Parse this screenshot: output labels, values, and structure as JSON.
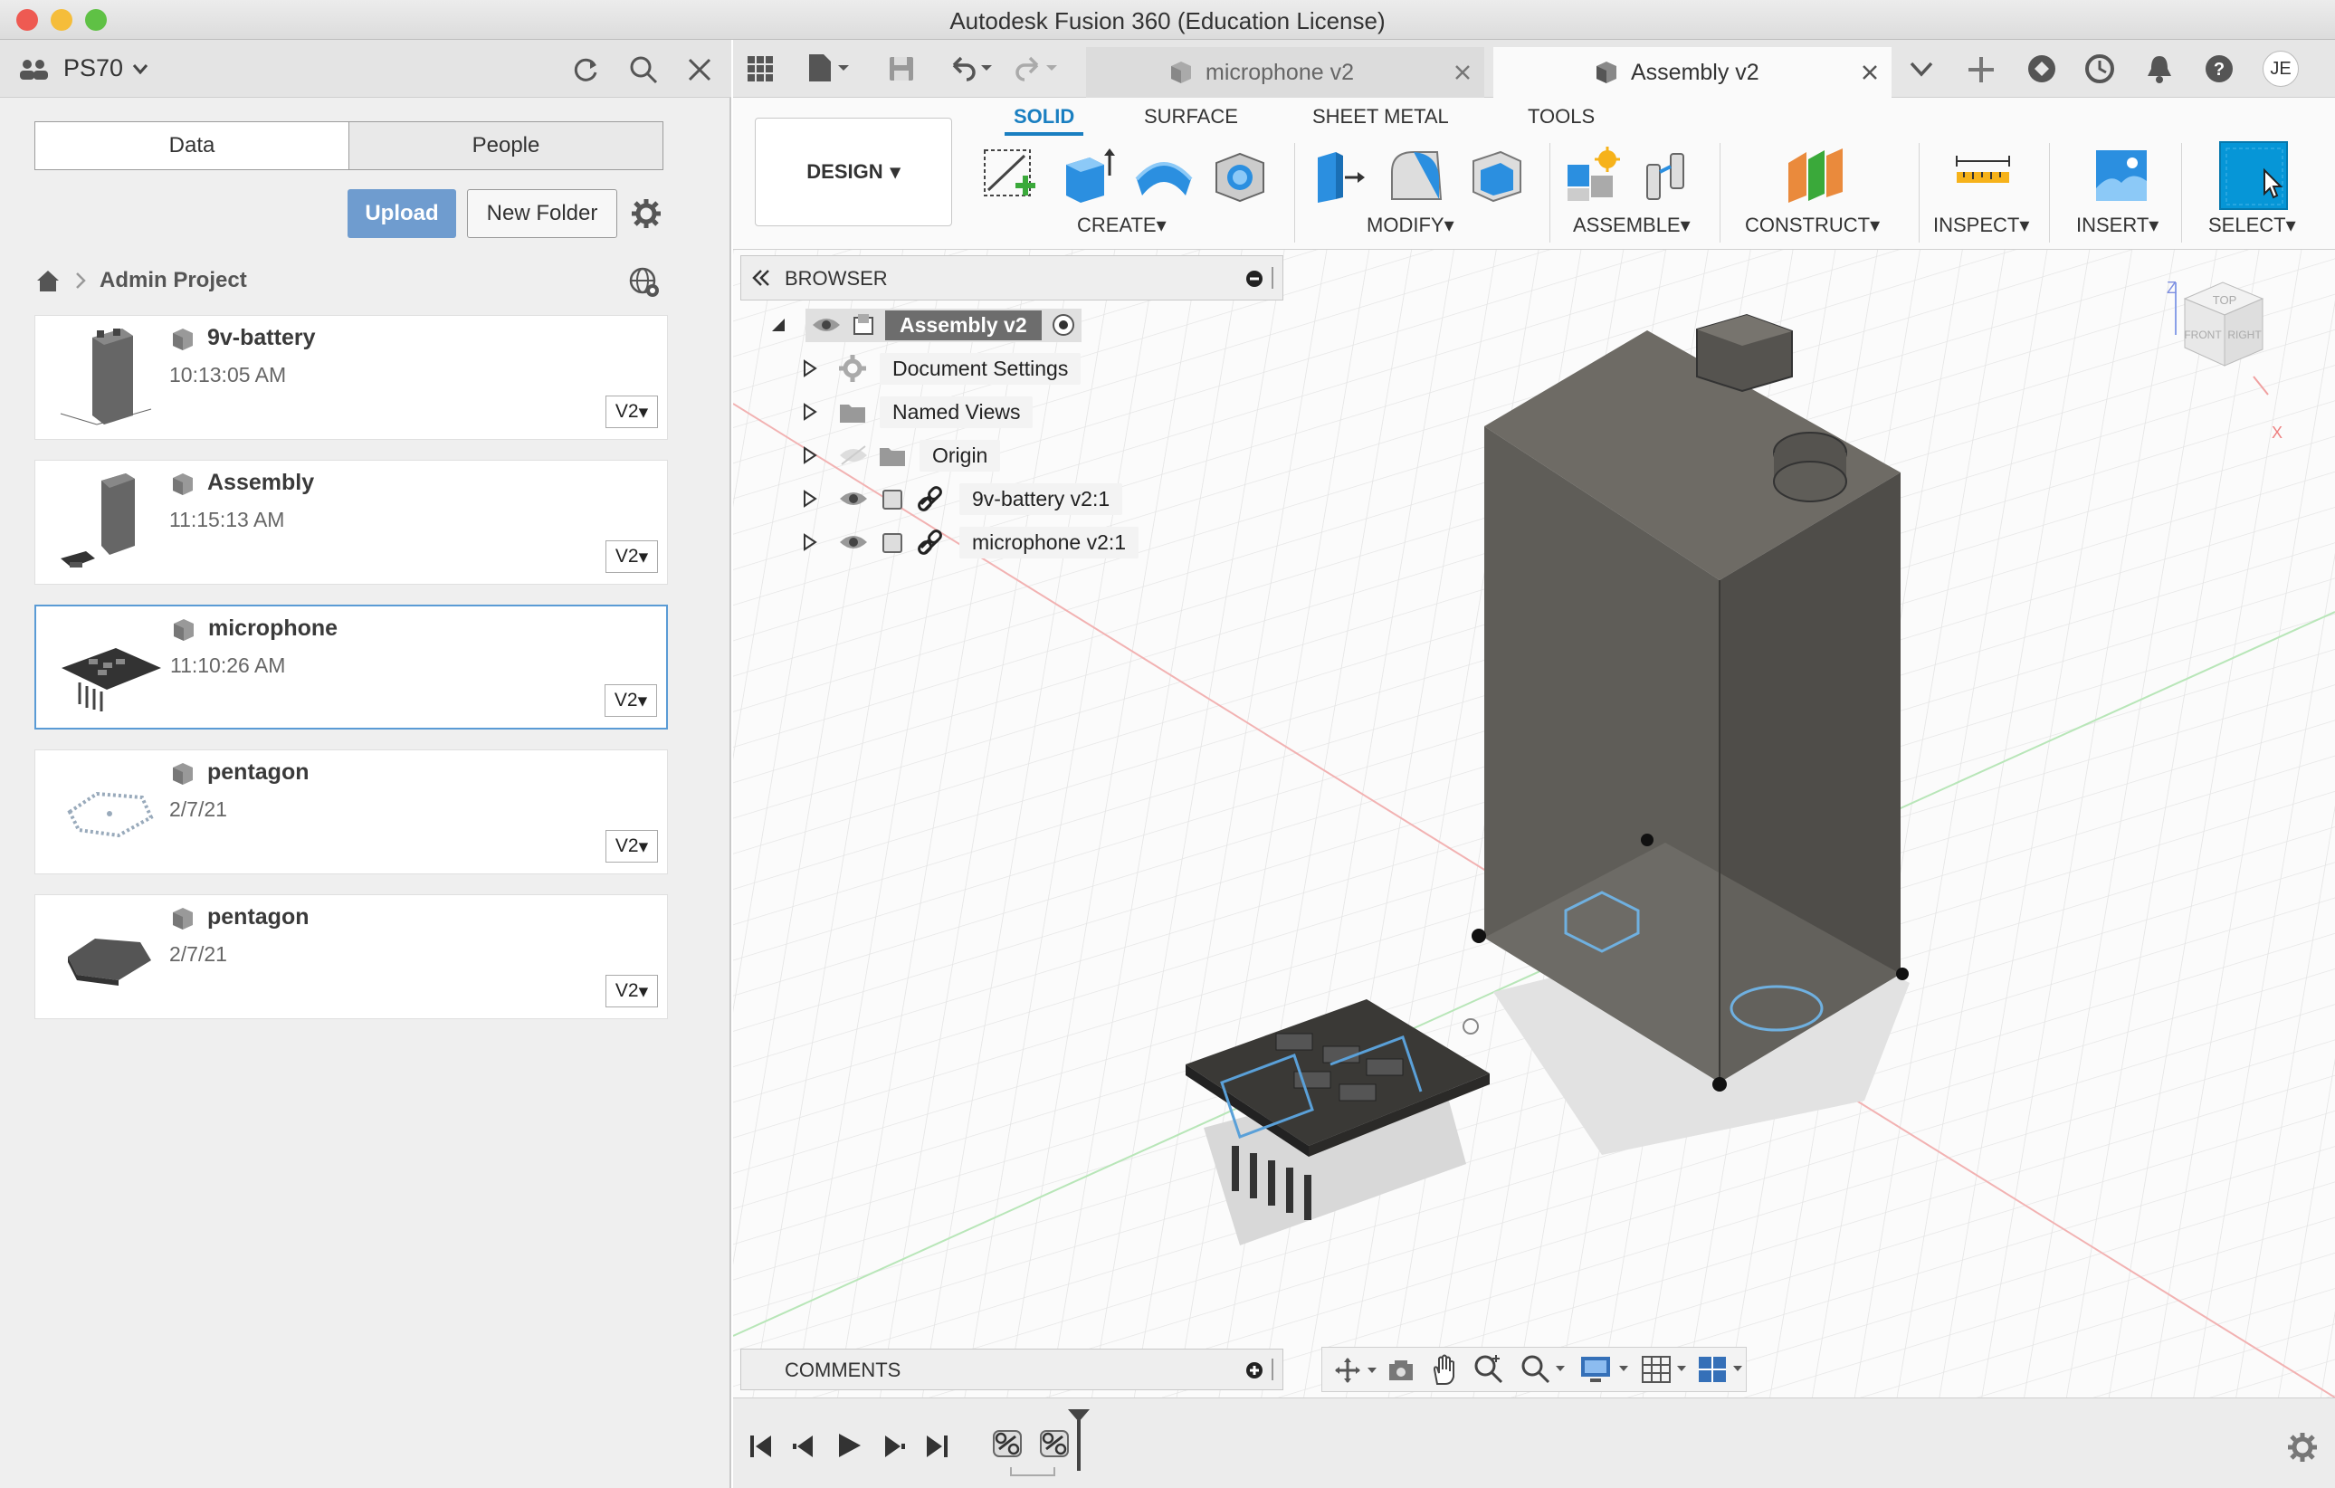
{
  "window": {
    "title": "Autodesk Fusion 360 (Education License)"
  },
  "left_panel": {
    "team": "PS70",
    "tabs": {
      "data": "Data",
      "people": "People"
    },
    "upload_label": "Upload",
    "new_folder_label": "New Folder",
    "breadcrumb": "Admin Project",
    "items": [
      {
        "name": "9v-battery",
        "time": "10:13:05 AM",
        "version": "V2"
      },
      {
        "name": "Assembly",
        "time": "11:15:13 AM",
        "version": "V2"
      },
      {
        "name": "microphone",
        "time": "11:10:26 AM",
        "version": "V2"
      },
      {
        "name": "pentagon",
        "time": "2/7/21",
        "version": "V2"
      },
      {
        "name": "pentagon",
        "time": "2/7/21",
        "version": "V2"
      }
    ]
  },
  "doc_tabs": [
    {
      "label": "microphone v2",
      "active": false
    },
    {
      "label": "Assembly v2",
      "active": true
    }
  ],
  "user_initials": "JE",
  "toolbar": {
    "workspace": "DESIGN",
    "tabs": [
      "SOLID",
      "SURFACE",
      "SHEET METAL",
      "TOOLS"
    ],
    "groups": [
      "CREATE",
      "MODIFY",
      "ASSEMBLE",
      "CONSTRUCT",
      "INSPECT",
      "INSERT",
      "SELECT"
    ]
  },
  "browser": {
    "title": "BROWSER",
    "root": "Assembly v2",
    "items": [
      "Document Settings",
      "Named Views",
      "Origin",
      "9v-battery v2:1",
      "microphone v2:1"
    ]
  },
  "viewcube": {
    "top": "TOP",
    "front": "FRONT",
    "right": "RIGHT",
    "z": "Z",
    "x": "X"
  },
  "comments": {
    "title": "COMMENTS"
  },
  "colors": {
    "accent": "#0696d7",
    "active_tab": "#1a7fc1",
    "upload": "#6f9ccf",
    "body_gray": "#5f5d58"
  }
}
